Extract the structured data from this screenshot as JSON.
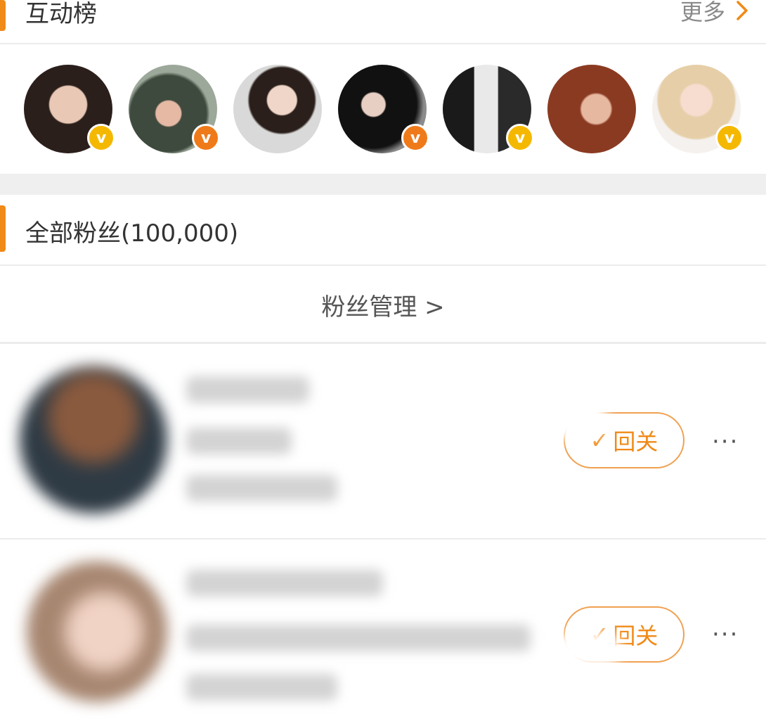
{
  "interaction_ranking": {
    "title": "互动榜",
    "more_label": "更多",
    "avatars": [
      {
        "verified_color": "#f5b800"
      },
      {
        "verified_color": "#ef7a1a"
      },
      {
        "verified_color": null
      },
      {
        "verified_color": "#ef7a1a"
      },
      {
        "verified_color": "#f5b800"
      },
      {
        "verified_color": null
      },
      {
        "verified_color": "#f5b800"
      }
    ]
  },
  "all_fans": {
    "title": "全部粉丝(100,000)",
    "manage_label": "粉丝管理 >",
    "items": [
      {
        "follow_label": "回关",
        "more_label": "···"
      },
      {
        "follow_label": "回关",
        "more_label": "···"
      }
    ]
  },
  "colors": {
    "accent": "#f08a18",
    "verified_gold": "#f5b800",
    "verified_orange": "#ef7a1a"
  }
}
